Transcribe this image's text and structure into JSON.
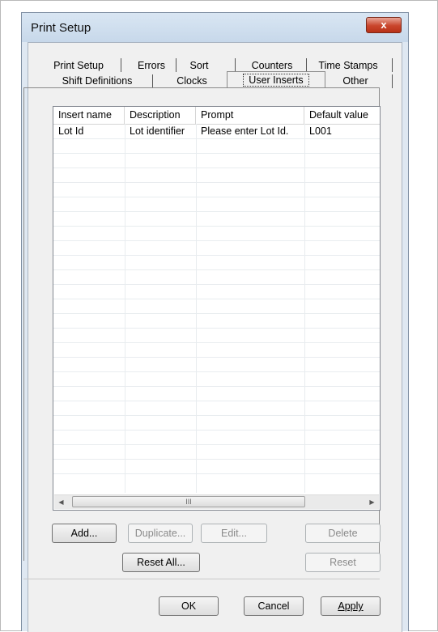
{
  "window": {
    "title": "Print Setup",
    "close_label": "x"
  },
  "tabs": {
    "row1": [
      "Print Setup",
      "Errors",
      "Sort",
      "Counters",
      "Time Stamps"
    ],
    "row2": [
      "Shift Definitions",
      "Clocks",
      "User Inserts",
      "Other"
    ],
    "active": "User Inserts"
  },
  "table": {
    "columns": [
      "Insert name",
      "Description",
      "Prompt",
      "Default value"
    ],
    "rows": [
      [
        "Lot Id",
        "Lot identifier",
        "Please enter Lot Id.",
        "L001"
      ]
    ]
  },
  "scrollbar": {
    "left_arrow": "◀",
    "right_arrow": "▶",
    "grip": "III"
  },
  "buttons": {
    "add": "Add...",
    "duplicate": "Duplicate...",
    "edit": "Edit...",
    "delete": "Delete",
    "reset_all": "Reset All...",
    "reset": "Reset",
    "ok": "OK",
    "cancel": "Cancel",
    "apply": "Apply"
  },
  "colors": {
    "close_button": "#c9452c",
    "titlebar": "#c7d8ea"
  }
}
